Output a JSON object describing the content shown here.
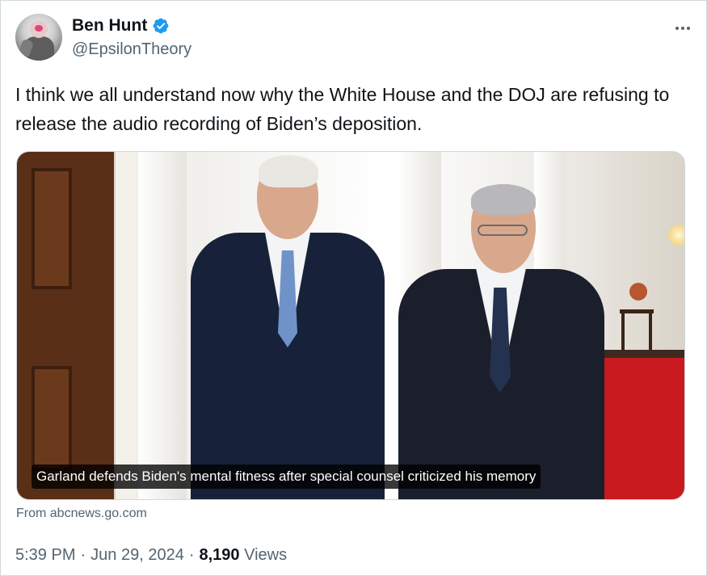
{
  "author": {
    "display_name": "Ben Hunt",
    "handle": "@EpsilonTheory",
    "verified": true,
    "verified_color": "#1d9bf0",
    "avatar_icon": "avatar-image"
  },
  "more_icon": "more-horizontal-icon",
  "tweet": {
    "text": "I think we all understand now why the White House and the DOJ are refusing to release the audio recording of Biden’s deposition."
  },
  "media": {
    "caption": "Garland defends Biden's mental fitness after special counsel criticized his memory",
    "source": "From abcnews.go.com"
  },
  "meta": {
    "time": "5:39 PM",
    "separator1": "·",
    "date": "Jun 29, 2024",
    "separator2": "·",
    "views_count": "8,190",
    "views_label": "Views"
  },
  "colors": {
    "text_primary": "#0f1419",
    "text_secondary": "#536471",
    "border": "#cfd9de"
  }
}
